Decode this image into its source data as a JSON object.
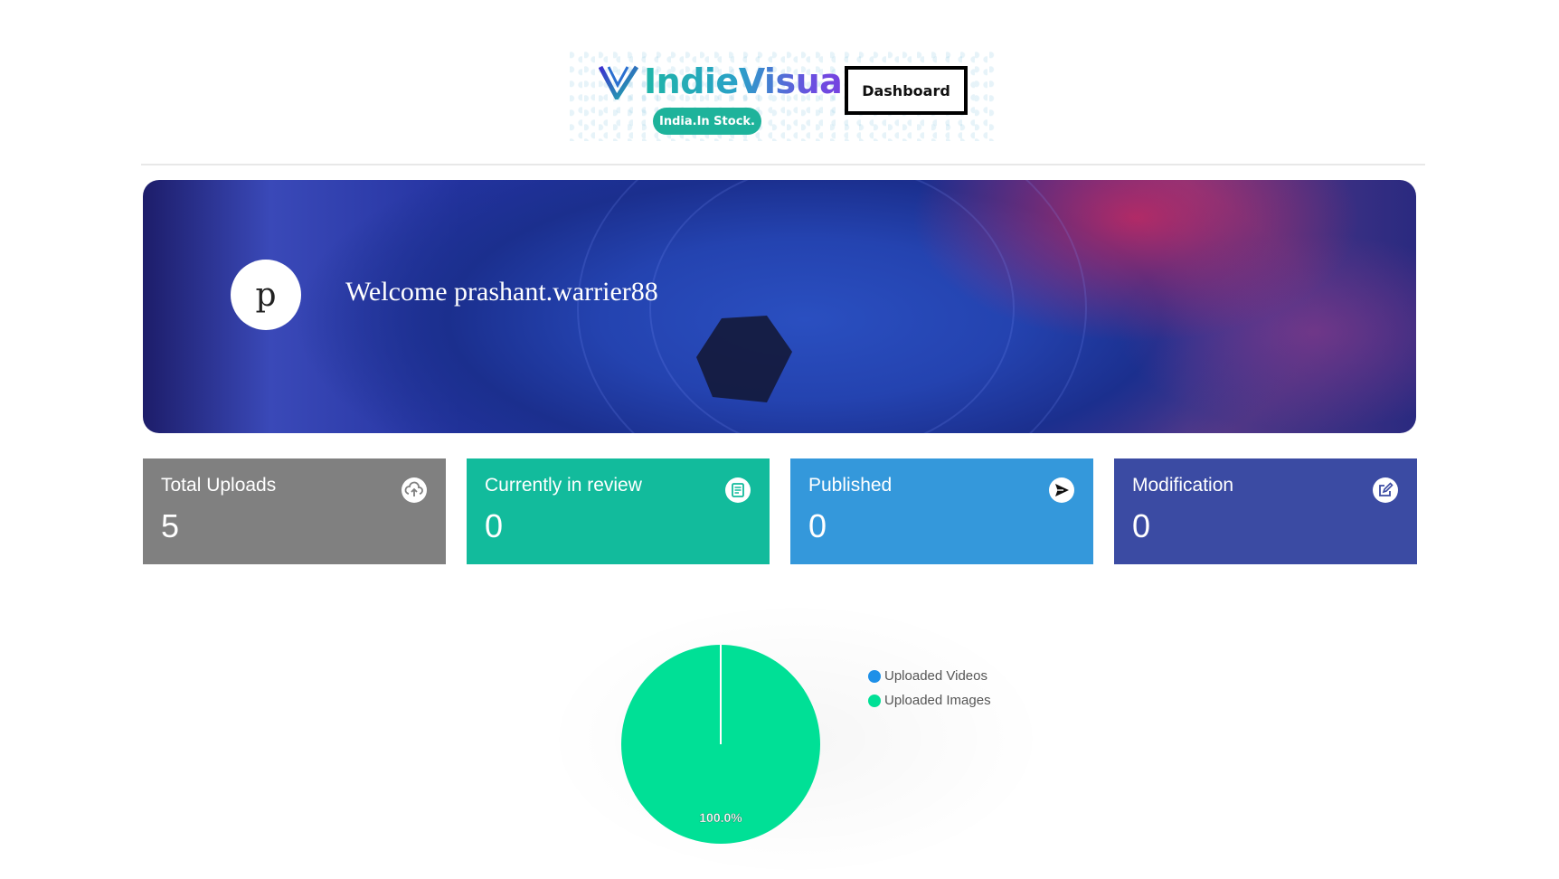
{
  "header": {
    "brand_name": "IndieVisual",
    "brand_tagline": "India.In Stock.",
    "dashboard_label": "Dashboard"
  },
  "banner": {
    "avatar_letter": "p",
    "welcome_text": "Welcome prashant.warrier88"
  },
  "stats": [
    {
      "label": "Total Uploads",
      "value": "5",
      "icon": "cloud-upload-icon",
      "color": "#808080"
    },
    {
      "label": "Currently in review",
      "value": "0",
      "icon": "review-list-icon",
      "color": "#12bb9c"
    },
    {
      "label": "Published",
      "value": "0",
      "icon": "send-icon",
      "color": "#3498db"
    },
    {
      "label": "Modification",
      "value": "0",
      "icon": "edit-icon",
      "color": "#3b4ba3"
    }
  ],
  "chart_data": {
    "type": "pie",
    "categories": [
      "Uploaded Videos",
      "Uploaded Images"
    ],
    "values": [
      0,
      5
    ],
    "colors": [
      "#1e90e8",
      "#00e096"
    ],
    "data_labels": [
      "",
      "100.0%"
    ],
    "legend_position": "right"
  }
}
